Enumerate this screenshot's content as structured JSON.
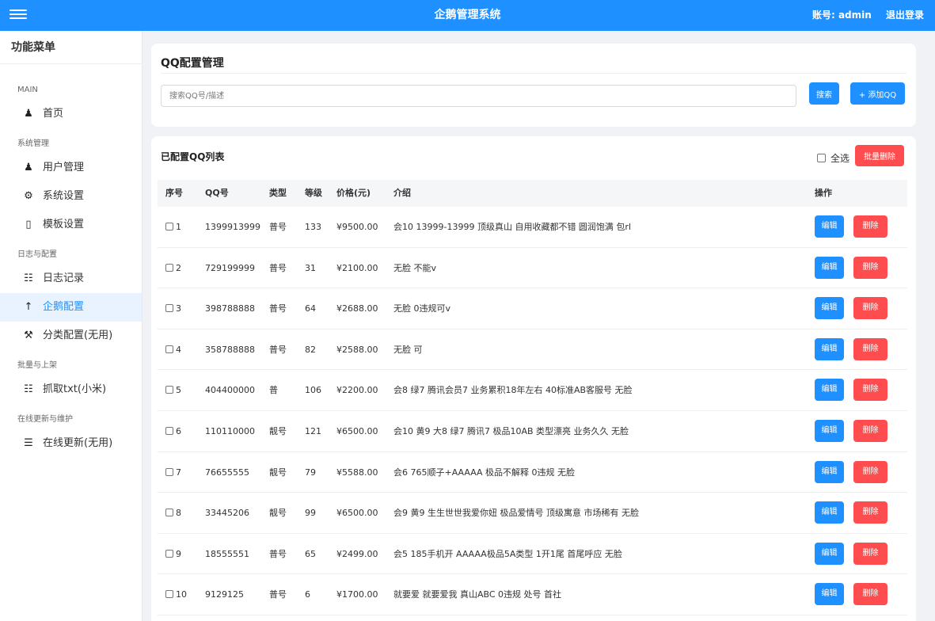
{
  "header": {
    "title": "企鹅管理系统",
    "account": "账号: admin",
    "logout": "退出登录"
  },
  "sidebar": {
    "title": "功能菜单",
    "groups": [
      {
        "label": "MAIN",
        "items": [
          {
            "label": "首页",
            "icon": "user-icon"
          }
        ]
      },
      {
        "label": "系统管理",
        "items": [
          {
            "label": "用户管理",
            "icon": "user-icon"
          },
          {
            "label": "系统设置",
            "icon": "gear-icon"
          },
          {
            "label": "模板设置",
            "icon": "square-icon"
          }
        ]
      },
      {
        "label": "日志与配置",
        "items": [
          {
            "label": "日志记录",
            "icon": "document-icon"
          },
          {
            "label": "企鹅配置",
            "icon": "penguin-icon",
            "active": true
          },
          {
            "label": "分类配置(无用)",
            "icon": "tools-icon"
          }
        ]
      },
      {
        "label": "批量与上架",
        "items": [
          {
            "label": "抓取txt(小米)",
            "icon": "document-icon"
          }
        ]
      },
      {
        "label": "在线更新与维护",
        "items": [
          {
            "label": "在线更新(无用)",
            "icon": "cabinet-icon"
          }
        ]
      }
    ]
  },
  "qq_config": {
    "title": "QQ配置管理",
    "search_placeholder": "搜索QQ号/描述",
    "search_btn": "搜索",
    "add_btn": "+ 添加QQ"
  },
  "qq_list": {
    "title": "已配置QQ列表",
    "select_all": "全选",
    "batch_delete": "批量删除",
    "columns": [
      "序号",
      "QQ号",
      "类型",
      "等级",
      "价格(元)",
      "介绍",
      "操作"
    ],
    "edit_label": "编辑",
    "delete_label": "删除",
    "rows": [
      {
        "idx": "1",
        "qq": "1399913999",
        "type": "普号",
        "level": "133",
        "price": "¥9500.00",
        "desc": "会10 13999-13999 顶级真山 自用收藏都不错 圆润饱满 包rl"
      },
      {
        "idx": "2",
        "qq": "729199999",
        "type": "普号",
        "level": "31",
        "price": "¥2100.00",
        "desc": "无脸 不能v"
      },
      {
        "idx": "3",
        "qq": "398788888",
        "type": "普号",
        "level": "64",
        "price": "¥2688.00",
        "desc": "无脸 0违规可v"
      },
      {
        "idx": "4",
        "qq": "358788888",
        "type": "普号",
        "level": "82",
        "price": "¥2588.00",
        "desc": "无脸 可"
      },
      {
        "idx": "5",
        "qq": "404400000",
        "type": "普",
        "level": "106",
        "price": "¥2200.00",
        "desc": "会8 绿7 腾讯会员7 业务累积18年左右 40标准AB客服号 无脸"
      },
      {
        "idx": "6",
        "qq": "110110000",
        "type": "靓号",
        "level": "121",
        "price": "¥6500.00",
        "desc": "会10 黄9 大8 绿7 腾讯7 极品10AB 类型漂亮 业务久久 无脸"
      },
      {
        "idx": "7",
        "qq": "76655555",
        "type": "靓号",
        "level": "79",
        "price": "¥5588.00",
        "desc": "会6 765顺子+AAAAA 极品不解释 0违规 无脸"
      },
      {
        "idx": "8",
        "qq": "33445206",
        "type": "靓号",
        "level": "99",
        "price": "¥6500.00",
        "desc": "会9 黄9 生生世世我爱你妞 极品爱情号 顶级寓意 市场稀有 无脸"
      },
      {
        "idx": "9",
        "qq": "18555551",
        "type": "普号",
        "level": "65",
        "price": "¥2499.00",
        "desc": "会5 185手机开 AAAAA极品5A类型 1开1尾 首尾呼应 无脸"
      },
      {
        "idx": "10",
        "qq": "9129125",
        "type": "普号",
        "level": "6",
        "price": "¥1700.00",
        "desc": "就要爱 就要爱我 真山ABC 0违规 处号 首社"
      }
    ]
  },
  "colors": {
    "primary": "#1e90ff",
    "danger": "#ff4d4f",
    "background": "#f0f2f5"
  }
}
